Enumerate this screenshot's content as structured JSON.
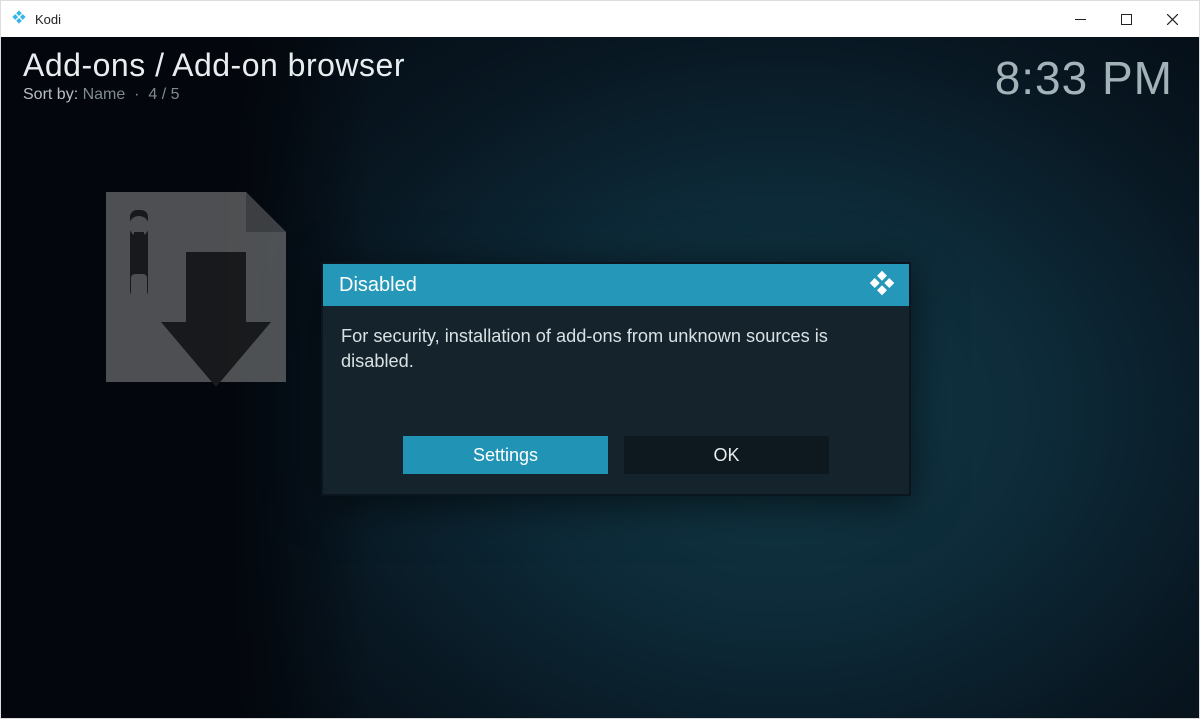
{
  "window": {
    "app_title": "Kodi"
  },
  "header": {
    "breadcrumb": "Add-ons / Add-on browser",
    "sort_label": "Sort by:",
    "sort_value": "Name",
    "position": "4 / 5",
    "clock": "8:33 PM"
  },
  "dialog": {
    "title": "Disabled",
    "message": "For security, installation of add-ons from unknown sources is disabled.",
    "settings_label": "Settings",
    "ok_label": "OK"
  },
  "icons": {
    "app_icon": "kodi-logo-icon",
    "sidebar_graphic": "zip-install-icon",
    "dialog_header_icon": "kodi-logo-icon"
  }
}
